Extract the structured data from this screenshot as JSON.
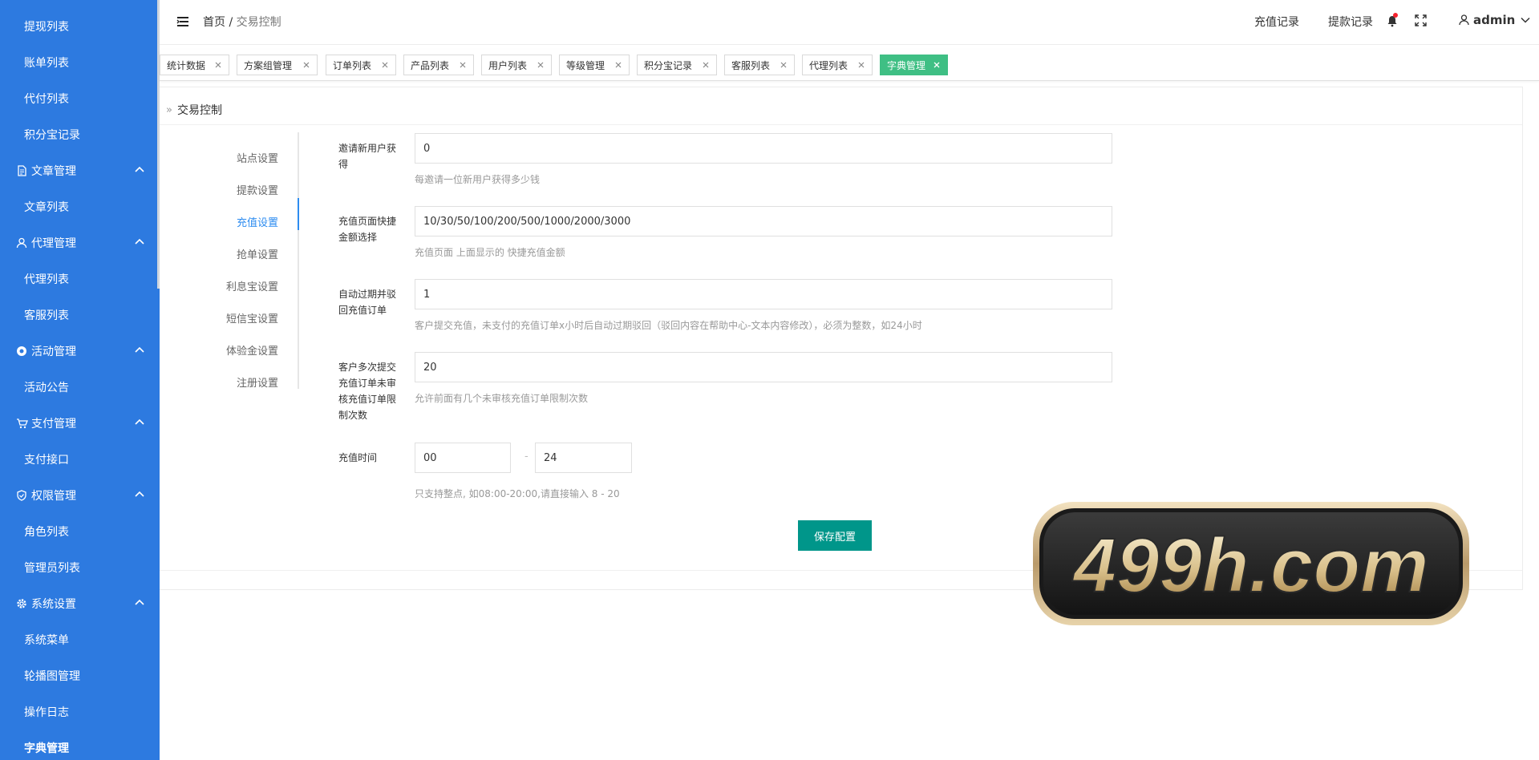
{
  "sidebar": {
    "items": [
      {
        "label": "提现列表",
        "type": "sub"
      },
      {
        "label": "账单列表",
        "type": "sub"
      },
      {
        "label": "代付列表",
        "type": "sub"
      },
      {
        "label": "积分宝记录",
        "type": "sub"
      },
      {
        "label": "文章管理",
        "type": "group",
        "icon": "document-icon"
      },
      {
        "label": "文章列表",
        "type": "sub"
      },
      {
        "label": "代理管理",
        "type": "group",
        "icon": "user-icon"
      },
      {
        "label": "代理列表",
        "type": "sub"
      },
      {
        "label": "客服列表",
        "type": "sub"
      },
      {
        "label": "活动管理",
        "type": "group",
        "icon": "activity-icon"
      },
      {
        "label": "活动公告",
        "type": "sub"
      },
      {
        "label": "支付管理",
        "type": "group",
        "icon": "cart-icon"
      },
      {
        "label": "支付接口",
        "type": "sub"
      },
      {
        "label": "权限管理",
        "type": "group",
        "icon": "shield-icon"
      },
      {
        "label": "角色列表",
        "type": "sub"
      },
      {
        "label": "管理员列表",
        "type": "sub"
      },
      {
        "label": "系统设置",
        "type": "group",
        "icon": "gear-icon"
      },
      {
        "label": "系统菜单",
        "type": "sub"
      },
      {
        "label": "轮播图管理",
        "type": "sub"
      },
      {
        "label": "操作日志",
        "type": "sub"
      },
      {
        "label": "字典管理",
        "type": "sub",
        "active": true
      }
    ]
  },
  "header": {
    "breadcrumb_home": "首页",
    "breadcrumb_sep": "/",
    "breadcrumb_current": "交易控制",
    "link_recharge": "充值记录",
    "link_withdraw": "提款记录",
    "user": "admin"
  },
  "tabs": [
    {
      "label": "统计数据"
    },
    {
      "label": "方案组管理"
    },
    {
      "label": "订单列表"
    },
    {
      "label": "产品列表"
    },
    {
      "label": "用户列表"
    },
    {
      "label": "等级管理"
    },
    {
      "label": "积分宝记录"
    },
    {
      "label": "客服列表"
    },
    {
      "label": "代理列表"
    },
    {
      "label": "字典管理",
      "active": true
    }
  ],
  "card": {
    "title": "交易控制",
    "menu": [
      {
        "label": "站点设置"
      },
      {
        "label": "提款设置"
      },
      {
        "label": "充值设置",
        "active": true
      },
      {
        "label": "抢单设置"
      },
      {
        "label": "利息宝设置"
      },
      {
        "label": "短信宝设置"
      },
      {
        "label": "体验金设置"
      },
      {
        "label": "注册设置"
      }
    ],
    "form": {
      "invite_label": "邀请新用户获得",
      "invite_value": "0",
      "invite_help": "每邀请一位新用户获得多少钱",
      "quick_label": "充值页面快捷金额选择",
      "quick_value": "10/30/50/100/200/500/1000/2000/3000",
      "quick_help": "充值页面 上面显示的 快捷充值金额",
      "expire_label": "自动过期并驳回充值订单",
      "expire_value": "1",
      "expire_help": "客户提交充值，未支付的充值订单x小时后自动过期驳回（驳回内容在帮助中心-文本内容修改），必须为整数，如24小时",
      "limit_label": "客户多次提交充值订单未审核充值订单限制次数",
      "limit_value": "20",
      "limit_help": "允许前面有几个未审核充值订单限制次数",
      "time_label": "充值时间",
      "time_start": "00",
      "time_dash": "-",
      "time_end": "24",
      "time_help": "只支持整点, 如08:00-20:00,请直接输入 8 - 20",
      "save_label": "保存配置"
    }
  },
  "watermark": {
    "text": "499h.com"
  },
  "colors": {
    "sidebar": "#2d7ae0",
    "tab_active": "#3fbf84",
    "save_button": "#00968a",
    "menu_active": "#2d8cf0",
    "notification_dot": "#f5222d"
  }
}
